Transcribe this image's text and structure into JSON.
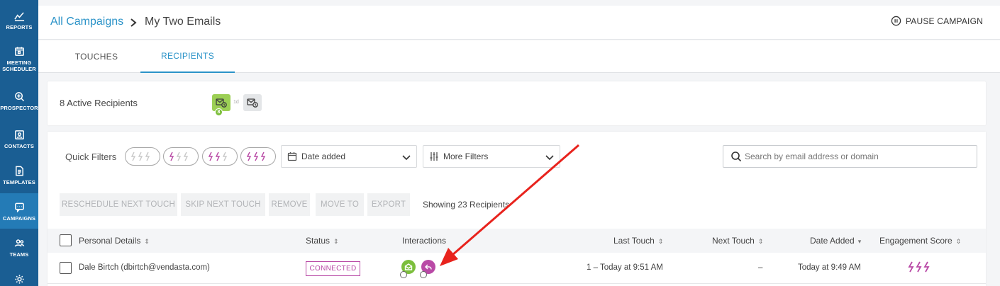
{
  "sidebar": {
    "items": [
      {
        "label": "REPORTS",
        "icon": "reports-icon"
      },
      {
        "label": "MEETING\nSCHEDULER",
        "icon": "calendar-icon"
      },
      {
        "label": "PROSPECTOR",
        "icon": "prospector-icon"
      },
      {
        "label": "CONTACTS",
        "icon": "contacts-icon"
      },
      {
        "label": "TEMPLATES",
        "icon": "templates-icon"
      },
      {
        "label": "CAMPAIGNS",
        "icon": "campaigns-icon",
        "active": true
      },
      {
        "label": "TEAMS",
        "icon": "teams-icon"
      },
      {
        "label": "",
        "icon": "gear-icon"
      }
    ]
  },
  "header": {
    "breadcrumb_link": "All Campaigns",
    "breadcrumb_current": "My Two Emails",
    "pause_label": "PAUSE CAMPAIGN"
  },
  "tabs": [
    {
      "label": "TOUCHES"
    },
    {
      "label": "RECIPIENTS",
      "active": true
    }
  ],
  "summary": {
    "active_recipients": "8 Active Recipients",
    "touch1_count": "8",
    "touch_delay": "1d"
  },
  "filters": {
    "quick_filters_label": "Quick Filters",
    "date_added": "Date added",
    "more_filters": "More Filters",
    "search_placeholder": "Search by email address or domain"
  },
  "actions": {
    "reschedule": "RESCHEDULE NEXT TOUCH",
    "skip": "SKIP NEXT TOUCH",
    "remove": "REMOVE",
    "move_to": "MOVE TO",
    "export": "EXPORT",
    "showing": "Showing 23 Recipients"
  },
  "table": {
    "columns": {
      "personal": "Personal Details",
      "status": "Status",
      "interactions": "Interactions",
      "last_touch": "Last Touch",
      "next_touch": "Next Touch",
      "date_added": "Date Added",
      "engagement": "Engagement Score"
    },
    "rows": [
      {
        "name": "Dale Birtch (dbirtch@vendasta.com)",
        "status": "CONNECTED",
        "last_touch": "1 – Today at 9:51 AM",
        "next_touch": "–",
        "date_added": "Today at 9:49 AM"
      }
    ]
  },
  "colors": {
    "sidebar": "#1a5e93",
    "accent": "#2b93c8",
    "connected": "#b94aa6",
    "touch_green": "#9ccf55",
    "engagement": "#b94aa6"
  }
}
